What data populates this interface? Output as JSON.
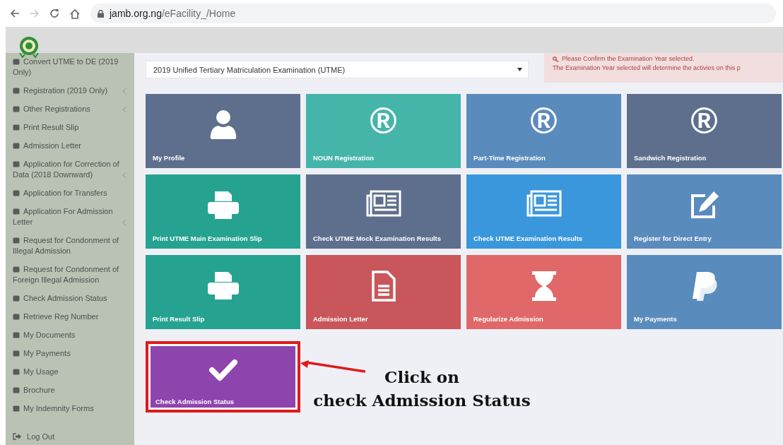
{
  "browser": {
    "url_host": "jamb.org.ng",
    "url_path": "/eFacility_/Home",
    "forward_disabled": true
  },
  "sidebar": {
    "items": [
      {
        "label": "Convert UTME to DE (2019 Only)",
        "expandable": false
      },
      {
        "label": "Registration (2019 Only)",
        "expandable": true
      },
      {
        "label": "Other Registrations",
        "expandable": true
      },
      {
        "label": "Print Result Slip",
        "expandable": false
      },
      {
        "label": "Admission Letter",
        "expandable": false
      },
      {
        "label": "Application for Correction of Data (2018 Downward)",
        "expandable": true
      },
      {
        "label": "Application for Transfers",
        "expandable": false
      },
      {
        "label": "Application For Admission Letter",
        "expandable": true
      },
      {
        "label": "Request for Condonment of Illegal Admission",
        "expandable": false
      },
      {
        "label": "Request for Condonment of Foreign Illegal Admission",
        "expandable": false
      },
      {
        "label": "Check Admission Status",
        "expandable": false
      },
      {
        "label": "Retrieve Reg Number",
        "expandable": false
      },
      {
        "label": "My Documents",
        "expandable": false
      },
      {
        "label": "My Payments",
        "expandable": false
      },
      {
        "label": "My Usage",
        "expandable": false
      },
      {
        "label": "Brochure",
        "expandable": false
      },
      {
        "label": "My Indemnity Forms",
        "expandable": false
      }
    ],
    "logout": "Log Out"
  },
  "exam_year": {
    "value": "2019 Unified Tertiary Matriculation Examination (UTME)"
  },
  "alert": {
    "lines": [
      "Please Confirm the Examination Year selected.",
      "The Examination Year selected will determine the activies on this p"
    ]
  },
  "tiles": [
    {
      "label": "My Profile",
      "kind": "profile",
      "color": "#5d6f8c",
      "selected": false
    },
    {
      "label": "NOUN Registration",
      "kind": "symbol",
      "symbol": "®",
      "color": "#45b5aa",
      "selected": false
    },
    {
      "label": "Part-Time Registration",
      "kind": "symbol",
      "symbol": "®",
      "color": "#5a8bbd",
      "selected": false
    },
    {
      "label": "Sandwich Registration",
      "kind": "symbol",
      "symbol": "®",
      "color": "#5d6f8c",
      "selected": false
    },
    {
      "label": "Print UTME Main Examination Slip",
      "kind": "printer",
      "color": "#26a390",
      "selected": false
    },
    {
      "label": "Check UTME Mock Examination Results",
      "kind": "newspaper",
      "color": "#5d6f8c",
      "selected": false
    },
    {
      "label": "Check UTME Examination Results",
      "kind": "newspaper",
      "color": "#3a97dc",
      "selected": false
    },
    {
      "label": "Register for Direct Entry",
      "kind": "edit",
      "color": "#5a8bbd",
      "selected": false
    },
    {
      "label": "Print Result Slip",
      "kind": "printer",
      "color": "#26a390",
      "selected": false
    },
    {
      "label": "Admission Letter",
      "kind": "document",
      "color": "#c9565a",
      "selected": false
    },
    {
      "label": "Regularize Admission",
      "kind": "hourglass",
      "color": "#e06868",
      "selected": false
    },
    {
      "label": "My Payments",
      "kind": "payment",
      "color": "#5a8bbd",
      "selected": false
    },
    {
      "label": "Check Admission Status",
      "kind": "check",
      "color": "#8e44ad",
      "selected": true
    }
  ],
  "annotation": {
    "lines": [
      "Click on",
      "check Admission Status"
    ]
  }
}
